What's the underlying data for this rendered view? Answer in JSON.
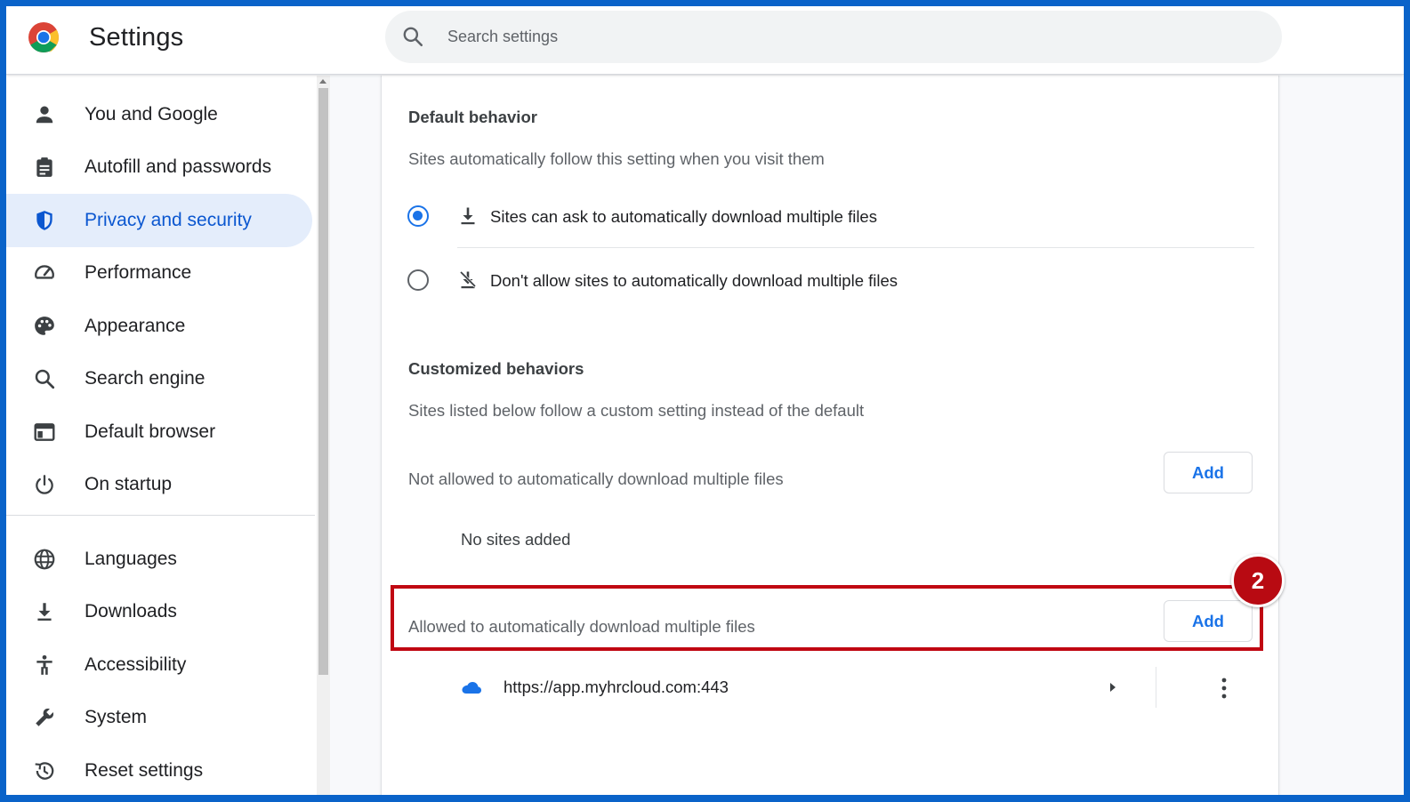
{
  "header": {
    "title": "Settings",
    "search_placeholder": "Search settings"
  },
  "sidebar": {
    "items": [
      {
        "label": "You and Google",
        "icon": "person-icon"
      },
      {
        "label": "Autofill and passwords",
        "icon": "clipboard-icon"
      },
      {
        "label": "Privacy and security",
        "icon": "shield-icon",
        "active": true
      },
      {
        "label": "Performance",
        "icon": "speedometer-icon"
      },
      {
        "label": "Appearance",
        "icon": "palette-icon"
      },
      {
        "label": "Search engine",
        "icon": "search-icon"
      },
      {
        "label": "Default browser",
        "icon": "browser-window-icon"
      },
      {
        "label": "On startup",
        "icon": "power-icon"
      },
      {
        "label": "Languages",
        "icon": "globe-icon"
      },
      {
        "label": "Downloads",
        "icon": "download-icon"
      },
      {
        "label": "Accessibility",
        "icon": "accessibility-icon"
      },
      {
        "label": "System",
        "icon": "wrench-icon"
      },
      {
        "label": "Reset settings",
        "icon": "history-icon"
      }
    ]
  },
  "main": {
    "default_behavior": {
      "title": "Default behavior",
      "description": "Sites automatically follow this setting when you visit them",
      "options": [
        {
          "label": "Sites can ask to automatically download multiple files",
          "checked": true,
          "icon": "download-icon"
        },
        {
          "label": "Don't allow sites to automatically download multiple files",
          "checked": false,
          "icon": "download-off-icon"
        }
      ]
    },
    "customized_behaviors": {
      "title": "Customized behaviors",
      "description": "Sites listed below follow a custom setting instead of the default",
      "not_allowed": {
        "label": "Not allowed to automatically download multiple files",
        "add_label": "Add",
        "empty_text": "No sites added"
      },
      "allowed": {
        "label": "Allowed to automatically download multiple files",
        "add_label": "Add",
        "sites": [
          {
            "url": "https://app.myhrcloud.com:443",
            "icon": "cloud-icon"
          }
        ]
      }
    }
  },
  "annotation": {
    "step_number": "2"
  },
  "colors": {
    "accent": "#1a73e8",
    "active_nav_bg": "#e4edfb",
    "annotation_red": "#c00712",
    "frame_border": "#0a63c9"
  }
}
